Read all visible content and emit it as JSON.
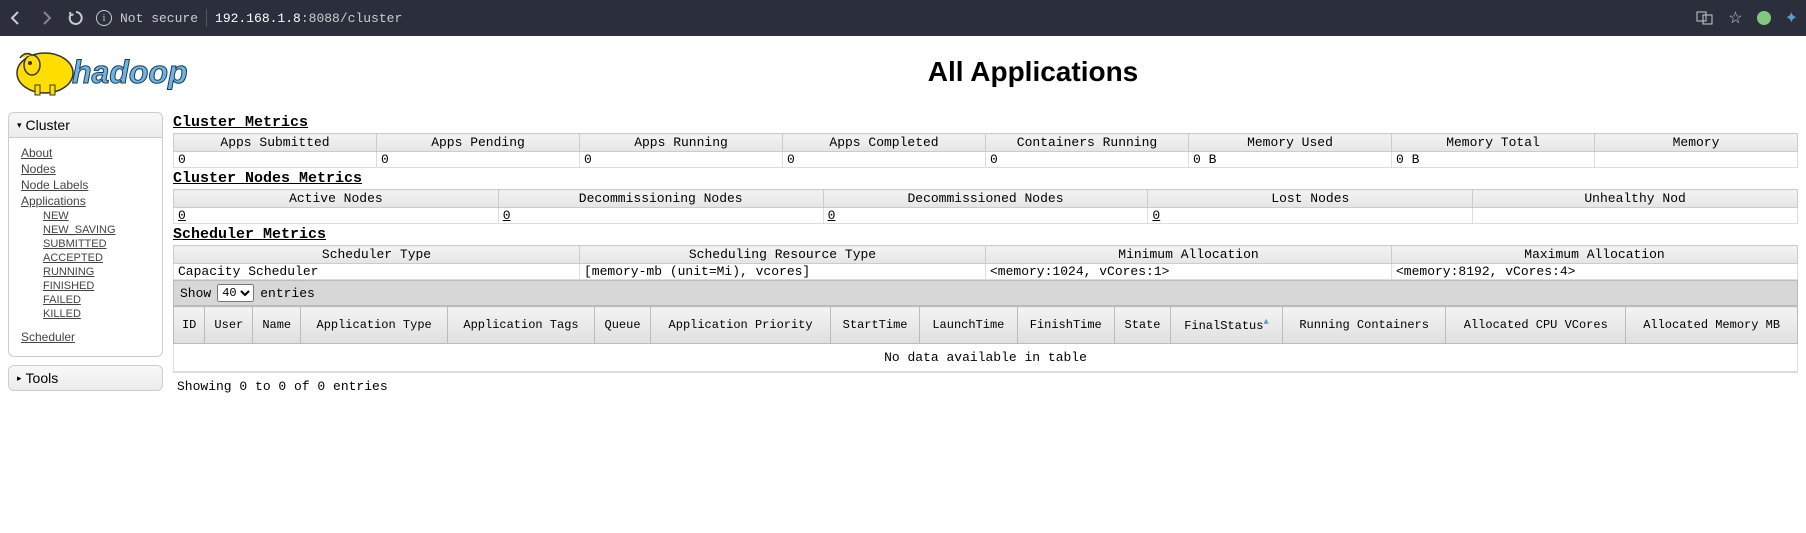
{
  "browser": {
    "security_label": "Not secure",
    "host": "192.168.1.8",
    "port_path": ":8088/cluster"
  },
  "page": {
    "logo_text": "hadoop",
    "title": "All Applications"
  },
  "sidebar": {
    "cluster_label": "Cluster",
    "about": "About",
    "nodes": "Nodes",
    "node_labels": "Node Labels",
    "applications": "Applications",
    "app_states": [
      "NEW",
      "NEW_SAVING",
      "SUBMITTED",
      "ACCEPTED",
      "RUNNING",
      "FINISHED",
      "FAILED",
      "KILLED"
    ],
    "scheduler": "Scheduler",
    "tools_label": "Tools"
  },
  "cluster_metrics": {
    "title": "Cluster Metrics",
    "headers": [
      "Apps Submitted",
      "Apps Pending",
      "Apps Running",
      "Apps Completed",
      "Containers Running",
      "Memory Used",
      "Memory Total",
      "Memory"
    ],
    "values": [
      "0",
      "0",
      "0",
      "0",
      "0",
      "0 B",
      "0 B",
      ""
    ]
  },
  "node_metrics": {
    "title": "Cluster Nodes Metrics",
    "headers": [
      "Active Nodes",
      "Decommissioning Nodes",
      "Decommissioned Nodes",
      "Lost Nodes",
      "Unhealthy Nod"
    ],
    "values": [
      "0",
      "0",
      "0",
      "0",
      ""
    ]
  },
  "scheduler_metrics": {
    "title": "Scheduler Metrics",
    "headers": [
      "Scheduler Type",
      "Scheduling Resource Type",
      "Minimum Allocation",
      "Maximum Allocation"
    ],
    "values": [
      "Capacity Scheduler",
      "[memory-mb (unit=Mi), vcores]",
      "<memory:1024, vCores:1>",
      "<memory:8192, vCores:4>"
    ]
  },
  "apps_table": {
    "show_label": "Show",
    "show_value": "40",
    "entries_label": "entries",
    "headers": [
      "ID",
      "User",
      "Name",
      "Application Type",
      "Application Tags",
      "Queue",
      "Application Priority",
      "StartTime",
      "LaunchTime",
      "FinishTime",
      "State",
      "FinalStatus",
      "Running Containers",
      "Allocated CPU VCores",
      "Allocated Memory MB"
    ],
    "no_data": "No data available in table",
    "footer": "Showing 0 to 0 of 0 entries"
  }
}
